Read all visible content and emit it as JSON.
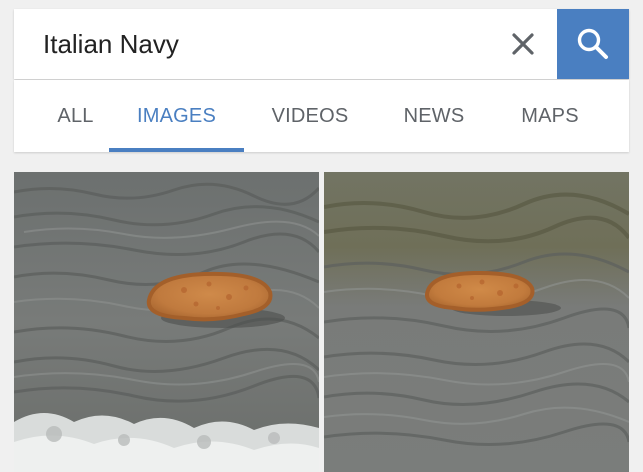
{
  "search": {
    "query": "Italian Navy",
    "clear_icon": "close-icon",
    "search_icon": "search-icon",
    "accent_color": "#4a7fc1"
  },
  "tabs": [
    {
      "label": "ALL",
      "active": false
    },
    {
      "label": "IMAGES",
      "active": true
    },
    {
      "label": "VIDEOS",
      "active": false
    },
    {
      "label": "NEWS",
      "active": false
    },
    {
      "label": "MAPS",
      "active": false
    }
  ],
  "results": [
    {
      "subject": "pizza floating on water"
    },
    {
      "subject": "pizza floating on water"
    }
  ]
}
